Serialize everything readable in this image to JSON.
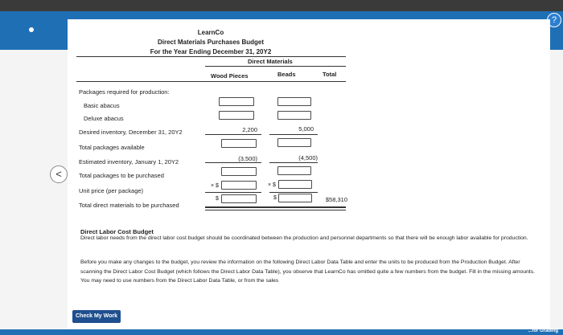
{
  "report": {
    "company": "LearnCo",
    "title": "Direct Materials Purchases Budget",
    "period": "For the Year Ending December 31, 20Y2",
    "group_header": "Direct Materials",
    "columns": [
      "Wood Pieces",
      "Beads",
      "Total"
    ]
  },
  "rows": {
    "packages_required": "Packages required for production:",
    "basic_abacus": "Basic abacus",
    "deluxe_abacus": "Deluxe abacus",
    "desired_inventory": "Desired inventory, December 31, 20Y2",
    "desired_inventory_wood": "2,200",
    "desired_inventory_beads": "5,000",
    "total_available": "Total packages available",
    "estimated_inventory": "Estimated inventory, January 1, 20Y2",
    "estimated_inventory_wood": "(3,500)",
    "estimated_inventory_beads": "(4,500)",
    "to_be_purchased": "Total packages to be purchased",
    "unit_price": "Unit price (per package)",
    "total_direct_materials": "Total direct materials to be purchased",
    "total_direct_materials_total": "$58,310",
    "times_symbol": "× $",
    "dollar_symbol": "$"
  },
  "labor": {
    "heading": "Direct Labor Cost Budget",
    "para1": "Direct labor needs from the direct labor cost budget should be coordinated between the production and personnel departments so that there will be enough labor available for production.",
    "para2": "Before you make any changes to the budget, you review the information on the following Direct Labor Data Table and enter the units to be produced from the Production Budget. After scanning the Direct Labor Cost Budget (which follows the Direct Labor Data Table), you observe that LearnCo has omitted quite a few numbers from the budget. Fill in the missing amounts. You may need to use numbers from the Direct Labor Data Table, or from the sales"
  },
  "buttons": {
    "check_my_work": "Check My Work"
  },
  "nav": {
    "previous_symbol": "<",
    "help_symbol": "?",
    "footer_link": "...for Grading"
  }
}
